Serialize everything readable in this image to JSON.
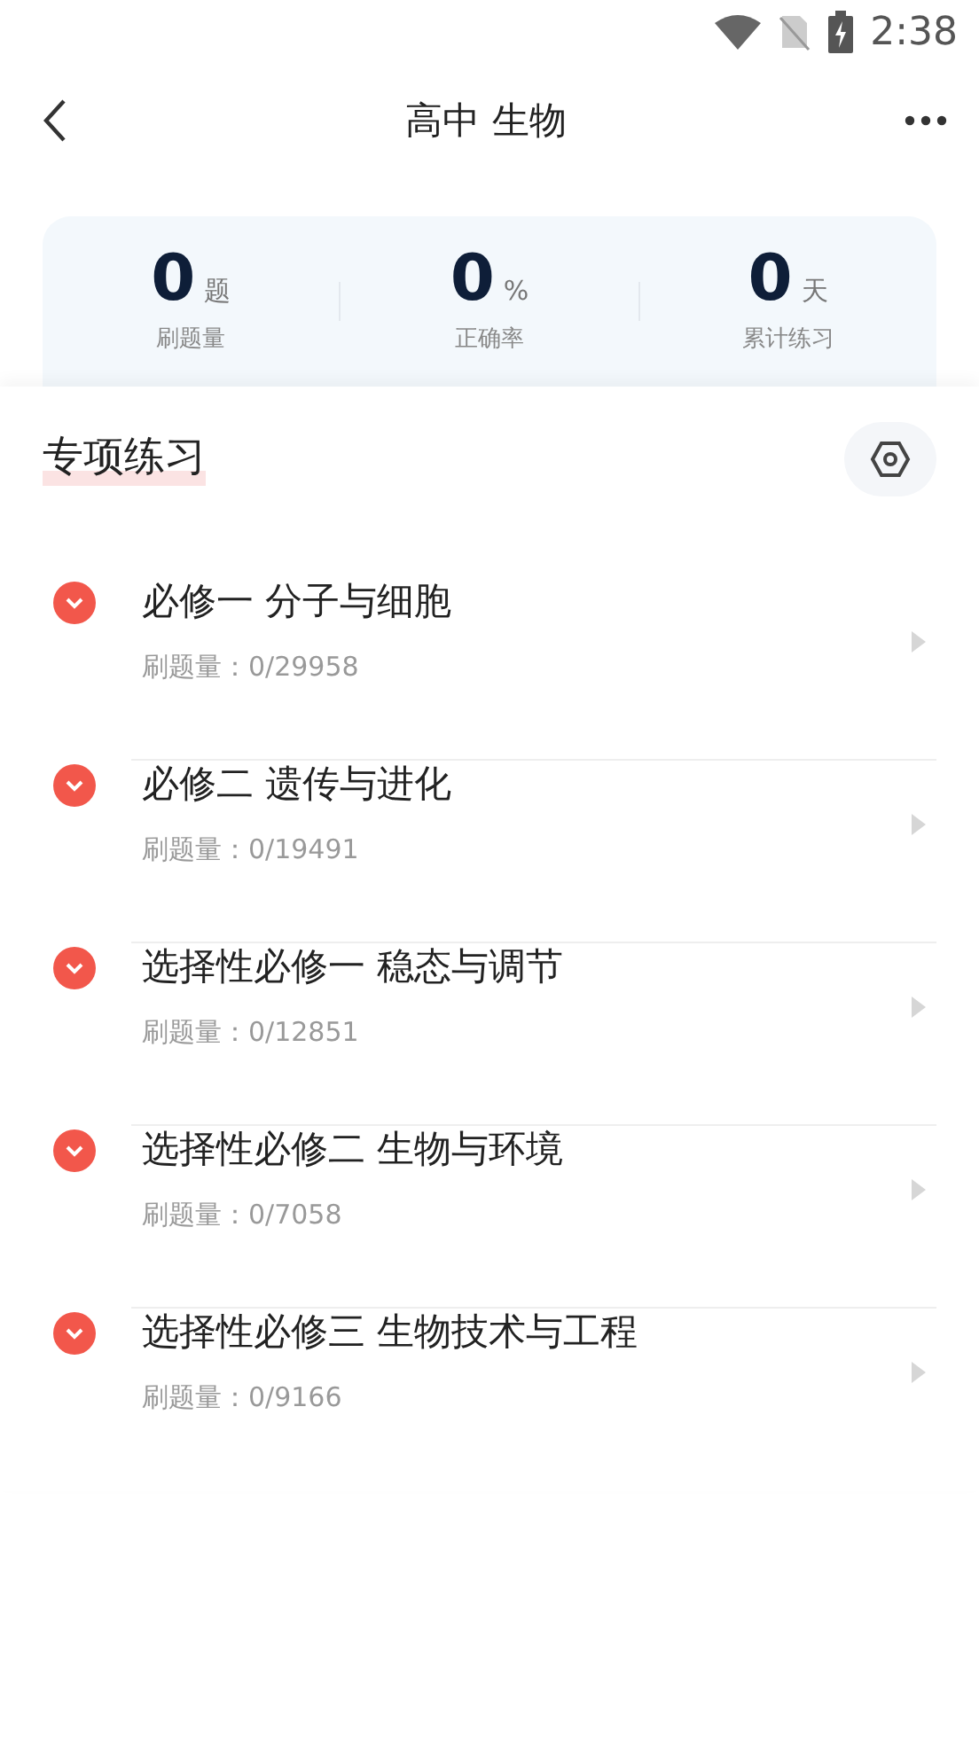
{
  "status_bar": {
    "time": "2:38"
  },
  "header": {
    "title": "高中 生物"
  },
  "stats": [
    {
      "value": "0",
      "unit": "题",
      "label": "刷题量"
    },
    {
      "value": "0",
      "unit": "%",
      "label": "正确率"
    },
    {
      "value": "0",
      "unit": "天",
      "label": "累计练习"
    }
  ],
  "section": {
    "title": "专项练习"
  },
  "items": [
    {
      "title": "必修一 分子与细胞",
      "count": "刷题量：0/29958"
    },
    {
      "title": "必修二 遗传与进化",
      "count": "刷题量：0/19491"
    },
    {
      "title": "选择性必修一 稳态与调节",
      "count": "刷题量：0/12851"
    },
    {
      "title": "选择性必修二 生物与环境",
      "count": "刷题量：0/7058"
    },
    {
      "title": "选择性必修三 生物技术与工程",
      "count": "刷题量：0/9166"
    }
  ]
}
